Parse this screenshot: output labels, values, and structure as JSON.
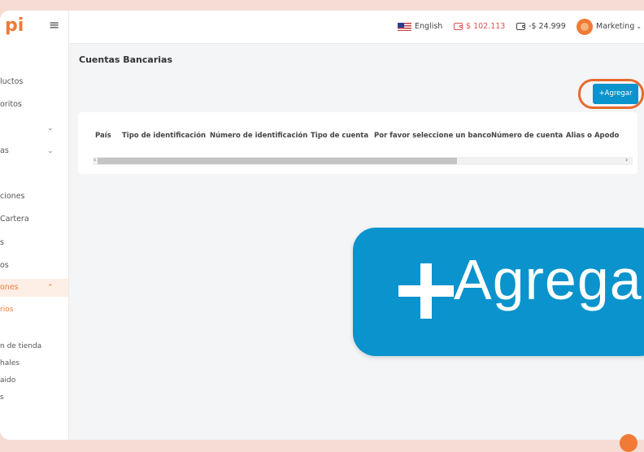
{
  "sidebar": {
    "logo": "pi",
    "hamburger_icon": "≡",
    "items": [
      {
        "label": "luctos",
        "chevron": ""
      },
      {
        "label": "oritos",
        "chevron": ""
      },
      {
        "label": "",
        "chevron": "⌄"
      },
      {
        "label": "as",
        "chevron": "⌄"
      },
      {
        "label": "ciones",
        "chevron": ""
      },
      {
        "label": "Cartera",
        "chevron": ""
      },
      {
        "label": "s",
        "chevron": ""
      },
      {
        "label": "os",
        "chevron": ""
      },
      {
        "label": "ones",
        "chevron": "⌃"
      },
      {
        "label": "rios",
        "chevron": ""
      },
      {
        "label": "n de tienda",
        "chevron": ""
      },
      {
        "label": "hales",
        "chevron": ""
      },
      {
        "label": "aido",
        "chevron": ""
      },
      {
        "label": "s",
        "chevron": ""
      }
    ]
  },
  "header": {
    "language": "English",
    "balance_red": "$ 102.113",
    "balance_neg": "-$ 24.999",
    "user": "Marketing",
    "user_chevron": "⌄"
  },
  "page": {
    "title": "Cuentas Bancarias",
    "add_button_label": "+Agregar"
  },
  "table": {
    "columns": [
      "País",
      "Tipo de identificación",
      "Número de identificación",
      "Tipo de cuenta",
      "Por favor seleccione un banco",
      "Número de cuenta",
      "Alias o Apodo"
    ],
    "scroll_left": "‹",
    "scroll_right": "›"
  },
  "zoom": {
    "label": "Agregar"
  },
  "colors": {
    "accent": "#f07a36",
    "primary_button": "#0a93cc",
    "balance_red": "#e05252"
  },
  "icons": {
    "language": "us-flag-icon",
    "balance_red": "wallet-icon",
    "balance_neg": "wallet-icon",
    "user": "avatar-icon"
  }
}
